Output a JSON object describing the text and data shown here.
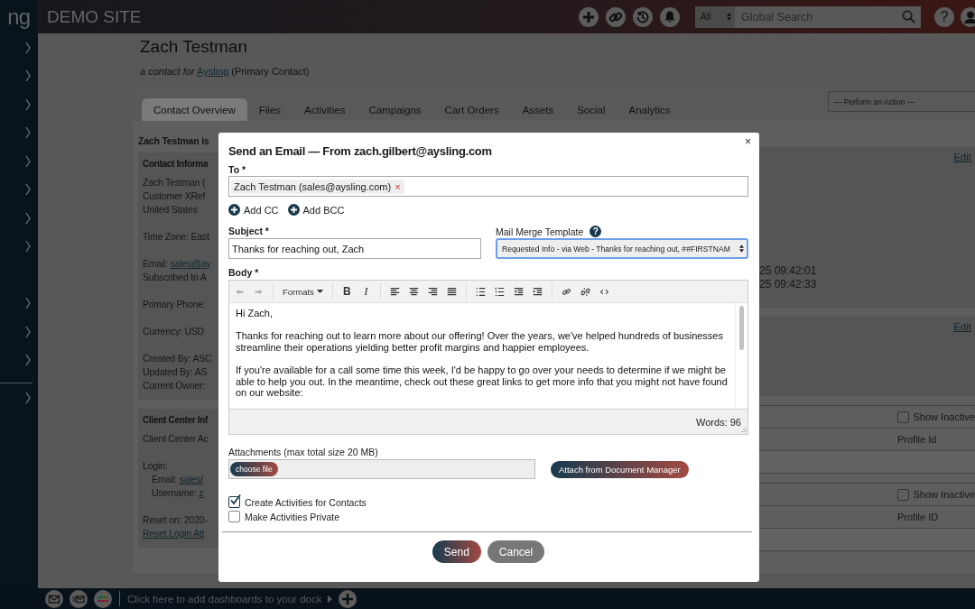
{
  "sidebar": {
    "logo": "ng"
  },
  "topbar": {
    "site_name": "DEMO SITE",
    "search_scope": "All",
    "search_placeholder": "Global Search",
    "help_label": "?"
  },
  "contact": {
    "name": "Zach Testman",
    "subtitle_prefix": "a contact for",
    "company_link": "Aysling",
    "subtitle_suffix": "(Primary Contact)"
  },
  "tabs": [
    {
      "label": "Contact Overview",
      "selected": true
    },
    {
      "label": "Files",
      "selected": false
    },
    {
      "label": "Activities",
      "selected": false
    },
    {
      "label": "Campaigns",
      "selected": false
    },
    {
      "label": "Cart Orders",
      "selected": false
    },
    {
      "label": "Assets",
      "selected": false
    },
    {
      "label": "Social",
      "selected": false
    },
    {
      "label": "Analytics",
      "selected": false
    }
  ],
  "action_select": {
    "value": "— Perform an Action —"
  },
  "left_column": {
    "heading": "Zach Testman is",
    "cards": [
      {
        "title": "Contact Informa",
        "lines": [
          {
            "kind": "text",
            "text": "Zach Testman ("
          },
          {
            "kind": "text",
            "text": "Customer XRef"
          },
          {
            "kind": "text",
            "text": "United States"
          },
          {
            "kind": "gap"
          },
          {
            "kind": "text",
            "text": "Time Zone: East"
          },
          {
            "kind": "gap"
          },
          {
            "kind": "labeled_link",
            "label": "Email:",
            "link": "sales@ay"
          },
          {
            "kind": "text",
            "text": "Subscribed to A"
          },
          {
            "kind": "gap"
          },
          {
            "kind": "text",
            "text": "Primary Phone:"
          },
          {
            "kind": "gap"
          },
          {
            "kind": "text",
            "text": "Currency: USD"
          },
          {
            "kind": "gap"
          },
          {
            "kind": "text",
            "text": "Created By: ASC"
          },
          {
            "kind": "text",
            "text": "Updated By: AS"
          },
          {
            "kind": "text",
            "text": "Current Owner:"
          }
        ]
      },
      {
        "title": "Client Center Inf",
        "lines": [
          {
            "kind": "text",
            "text": "Client Center Ac"
          },
          {
            "kind": "gap"
          },
          {
            "kind": "text",
            "text": "Login:"
          },
          {
            "kind": "sub_link",
            "label": "Email:",
            "link": "sales("
          },
          {
            "kind": "sub_link",
            "label": "Username:",
            "link": "z"
          },
          {
            "kind": "gap"
          },
          {
            "kind": "text",
            "text": "Reset on: 2020-"
          },
          {
            "kind": "link",
            "link": "Reset Login Att"
          }
        ]
      }
    ]
  },
  "right_column": {
    "cards": [
      {
        "edit_link": "Edit",
        "lines": [
          "25 09:42:01",
          "25 09:42:33"
        ]
      },
      {
        "edit_link": "Edit"
      }
    ],
    "tables": [
      {
        "show_inactive": {
          "label": "Show Inactive",
          "checked": false
        },
        "column": "Profile Id"
      },
      {
        "show_inactive": {
          "label": "Show Inactive",
          "checked": false
        },
        "column": "Profile ID"
      }
    ]
  },
  "email_dialog": {
    "title": "Send an Email — From zach.gilbert@aysling.com",
    "close_label": "×",
    "to": {
      "label": "To *",
      "recipients": [
        {
          "text": "Zach Testman (sales@aysling.com)",
          "remove_label": "×"
        }
      ]
    },
    "add_links": [
      "Add CC",
      "Add BCC"
    ],
    "subject": {
      "label": "Subject *",
      "value": "Thanks for reaching out, Zach"
    },
    "template": {
      "label": "Mail Merge Template",
      "help_label": "?",
      "value": "Requested Info - via Web - Thanks for reaching out, ##FIRSTNAM"
    },
    "body": {
      "label": "Body *",
      "toolbar": {
        "formats": "Formats",
        "bold": "B",
        "italic": "I"
      },
      "paragraphs": [
        "Hi Zach,",
        "Thanks for reaching out to learn more about our offering! Over the years, we've helped hundreds of businesses streamline their operations yielding better profit margins and happier employees.",
        "If you're available for a call some time this week, I'd be happy to go over your needs to determine if we might be able to help you out. In the meantime, check out these great links to get more info that you might not have found on our website:"
      ],
      "word_count": "Words: 96"
    },
    "attachments": {
      "label": "Attachments (max total size 20 MB)",
      "choose_file": "choose file",
      "attach_button": "Attach from Document Manager"
    },
    "options": [
      {
        "label": "Create Activities for Contacts",
        "checked": true
      },
      {
        "label": "Make Activities Private",
        "checked": false
      }
    ],
    "buttons": [
      {
        "label": "Send",
        "kind": "primary"
      },
      {
        "label": "Cancel",
        "kind": "secondary"
      }
    ]
  },
  "dock": {
    "hint": "Click here to add dashboards to your dock"
  }
}
